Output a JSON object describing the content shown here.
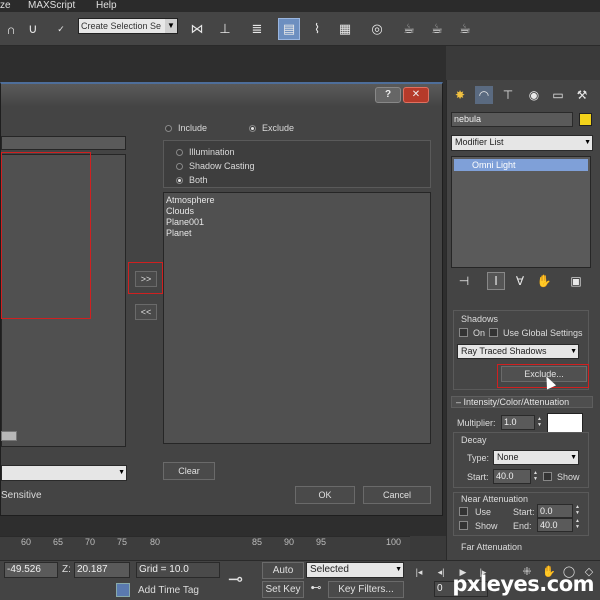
{
  "menubar": {
    "items": [
      "ze",
      "MAXScript",
      "Help"
    ]
  },
  "toolbar": {
    "selection_set_placeholder": "Create Selection Se"
  },
  "dialog": {
    "mode": {
      "include_label": "Include",
      "exclude_label": "Exclude",
      "selected": "Exclude"
    },
    "scope": {
      "illumination_label": "Illumination",
      "shadow_casting_label": "Shadow Casting",
      "both_label": "Both",
      "selected": "Both"
    },
    "excluded_items": [
      "Atmosphere",
      "Clouds",
      "Plane001",
      "Planet"
    ],
    "add_button_label": ">>",
    "remove_button_label": "<<",
    "clear_button_label": "Clear",
    "case_sensitive_label": "Sensitive",
    "ok_label": "OK",
    "cancel_label": "Cancel",
    "help_button_label": "?"
  },
  "command_panel": {
    "object_name": "nebula",
    "object_color": "#f2d21a",
    "modifier_list_label": "Modifier List",
    "stack_items": [
      "Omni Light"
    ],
    "shadows": {
      "title": "Shadows",
      "on_label": "On",
      "use_global_label": "Use Global Settings",
      "type_value": "Ray Traced Shadows",
      "exclude_button_label": "Exclude..."
    },
    "intensity": {
      "title": "Intensity/Color/Attenuation",
      "multiplier_label": "Multiplier:",
      "multiplier_value": "1.0",
      "color_swatch": "#ffffff",
      "decay_title": "Decay",
      "type_label": "Type:",
      "type_value": "None",
      "start_label": "Start:",
      "start_value": "40.0",
      "show_label": "Show"
    },
    "near_atten": {
      "title": "Near Attenuation",
      "use_label": "Use",
      "start_label": "Start:",
      "start_value": "0.0",
      "show_label": "Show",
      "end_label": "End:",
      "end_value": "40.0"
    },
    "far_atten": {
      "title": "Far Attenuation"
    }
  },
  "timeline": {
    "ticks": [
      "60",
      "65",
      "70",
      "75",
      "80",
      "85",
      "90",
      "95",
      "100"
    ]
  },
  "statusbar": {
    "x_value": "-49.526",
    "z_label": "Z:",
    "z_value": "20.187",
    "grid_label": "Grid = 10.0",
    "add_time_tag": "Add Time Tag",
    "auto_key_label": "Auto Key",
    "set_key_label": "Set Key",
    "selected_value": "Selected",
    "key_filters_label": "Key Filters...",
    "frame_value": "0"
  },
  "watermark": "pxleyes.com",
  "colors": {
    "accent": "#6d8fc0",
    "highlight_red": "#d02020",
    "stack_selection": "#7fa0d8"
  }
}
